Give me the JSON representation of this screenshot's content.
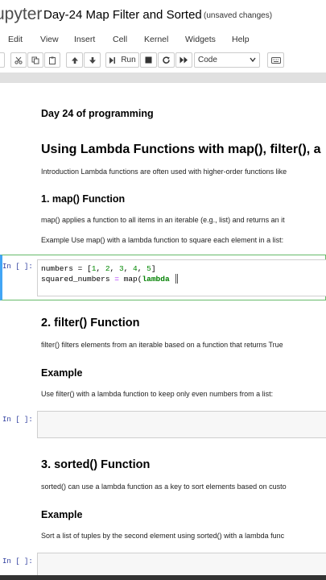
{
  "header": {
    "logo": "upyter",
    "notebook_title": "Day-24 Map Filter and Sorted",
    "save_status": "(unsaved changes)"
  },
  "menu": [
    "Edit",
    "View",
    "Insert",
    "Cell",
    "Kernel",
    "Widgets",
    "Help"
  ],
  "toolbar": {
    "run_label": "Run",
    "cell_type": "Code",
    "icons": [
      "cut-icon",
      "copy-icon",
      "paste-icon",
      "move-up-icon",
      "move-down-icon",
      "run-icon",
      "stop-icon",
      "restart-icon",
      "fast-forward-icon",
      "keyboard-icon"
    ]
  },
  "cells": {
    "day_title": "Day 24 of programming",
    "main_heading": "Using Lambda Functions with map(), filter(), a",
    "intro": "Introduction Lambda functions are often used with higher-order functions like",
    "map_heading": "1. map() Function",
    "map_desc": "map() applies a function to all items in an iterable (e.g., list) and returns an it",
    "map_example": "Example Use map() with a lambda function to square each element in a list:",
    "prompt": "In [ ]:",
    "code_line1_a": "numbers = [",
    "code_nums": [
      "1",
      "2",
      "3",
      "4",
      "5"
    ],
    "code_line2_a": "squared_numbers ",
    "code_line2_eq": "=",
    "code_line2_b": " map(",
    "code_line2_kw": "lambda",
    "filter_heading": "2. filter() Function",
    "filter_desc": "filter() filters elements from an iterable based on a function that returns True",
    "filter_example_heading": "Example",
    "filter_example": "Use filter() with a lambda function to keep only even numbers from a list:",
    "sorted_heading": "3. sorted() Function",
    "sorted_desc": "sorted() can use a lambda function as a key to sort elements based on custo",
    "sorted_example_heading": "Example",
    "sorted_example": "Sort a list of tuples by the second element using sorted() with a lambda func"
  }
}
